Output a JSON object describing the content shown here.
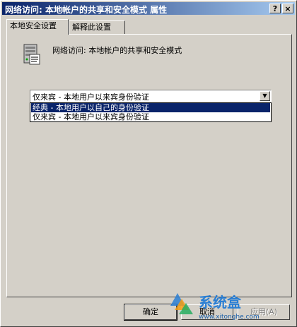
{
  "window": {
    "title": "网络访问: 本地帐户的共享和安全模式 属性",
    "help_button": "?",
    "close_button": "×"
  },
  "tabs": [
    {
      "label": "本地安全设置"
    },
    {
      "label": "解释此设置"
    }
  ],
  "policy": {
    "label": "网络访问: 本地帐户的共享和安全模式",
    "icon": "policy-server-icon"
  },
  "dropdown": {
    "selected": "仅来宾 - 本地用户以来宾身份验证",
    "options": [
      "经典 - 本地用户以自己的身份验证",
      "仅来宾 - 本地用户以来宾身份验证"
    ],
    "highlighted_index": 0
  },
  "buttons": {
    "ok": "确定",
    "cancel": "取消",
    "apply": "应用(A)"
  },
  "watermark": {
    "text": "系统盒",
    "url": "www.xitonghe.com"
  },
  "colors": {
    "titlebar_start": "#0a246a",
    "titlebar_end": "#a6caf0",
    "selection": "#0a246a",
    "face": "#d4d0c8"
  }
}
